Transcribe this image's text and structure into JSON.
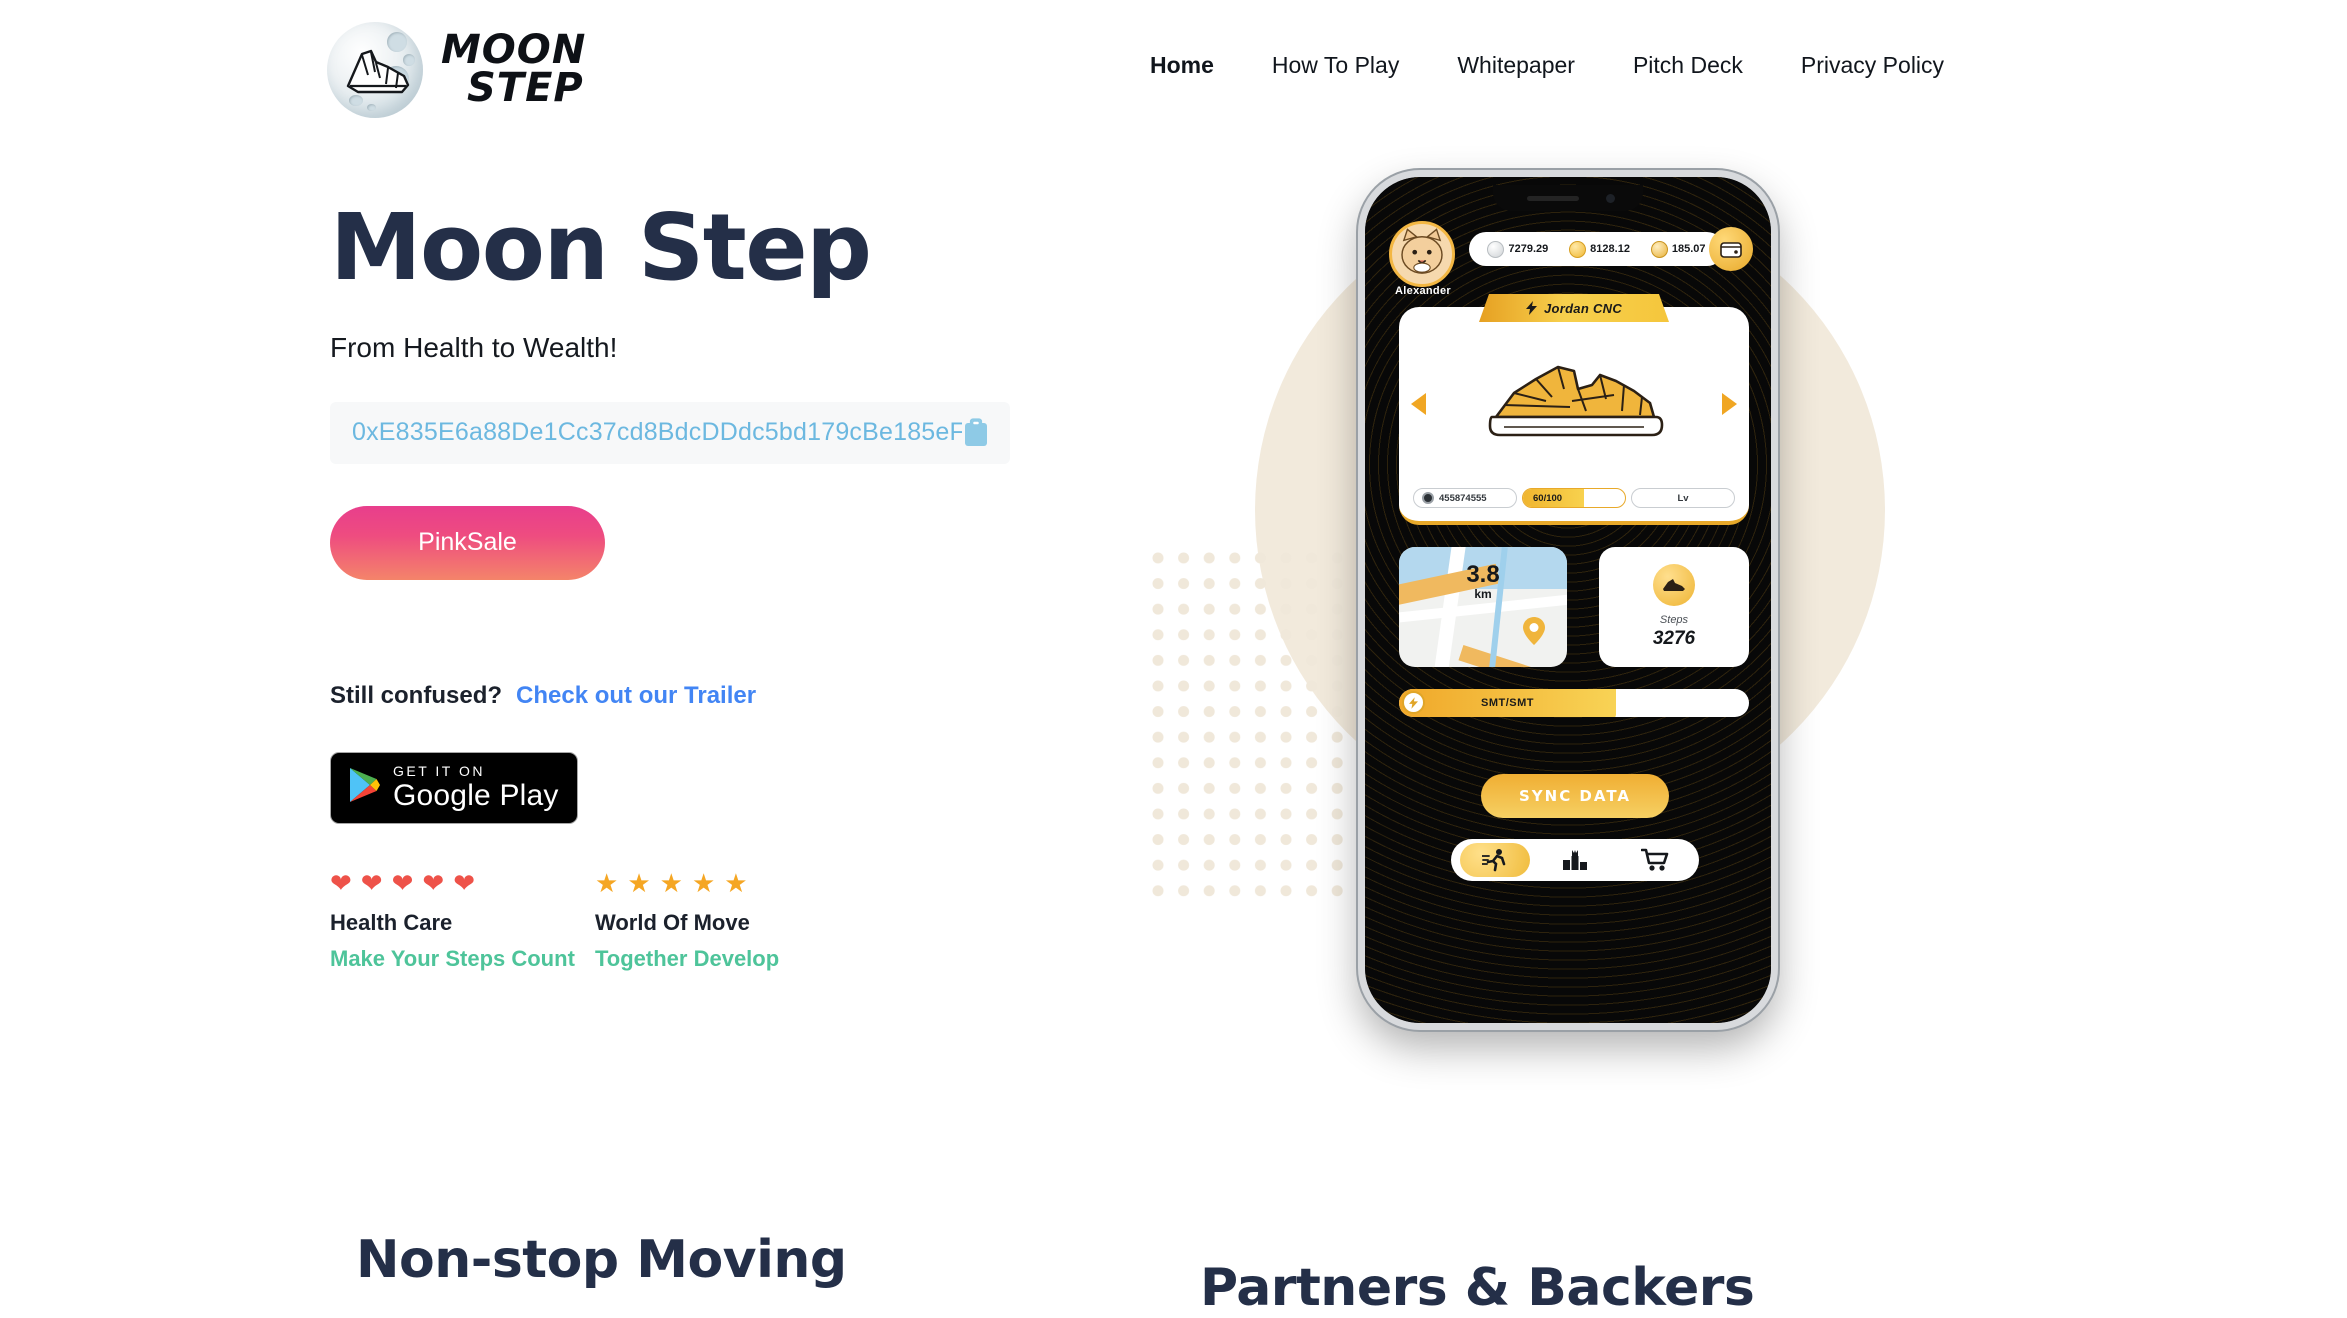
{
  "header": {
    "logo_alt": "moon-sneaker-logo",
    "brand_line1": "MOON",
    "brand_line2": "STEP",
    "nav": [
      {
        "label": "Home",
        "active": true
      },
      {
        "label": "How To Play",
        "active": false
      },
      {
        "label": "Whitepaper",
        "active": false
      },
      {
        "label": "Pitch Deck",
        "active": false
      },
      {
        "label": "Privacy Policy",
        "active": false
      }
    ]
  },
  "hero": {
    "title": "Moon Step",
    "subtitle": "From Health to Wealth!",
    "contract_address": "0xE835E6a88De1Cc37cd8BdcDDdc5bd179cBe185eF",
    "copy_icon": "clipboard-icon",
    "cta_label": "PinkSale",
    "confused_label": "Still confused?",
    "trailer_link": "Check out our Trailer",
    "google_play": {
      "small": "GET IT ON",
      "big": "Google Play",
      "icon": "google-play-icon"
    },
    "features": [
      {
        "icon": "heart-icon",
        "icon_count": 5,
        "icon_color": "#ee5249",
        "title": "Health Care",
        "subtitle": "Make Your Steps Count"
      },
      {
        "icon": "star-icon",
        "icon_count": 5,
        "icon_color": "#f5a623",
        "title": "World Of Move",
        "subtitle": "Together Develop"
      }
    ]
  },
  "phone": {
    "user_name": "Alexander",
    "avatar_icon": "cat-avatar-icon",
    "stats": [
      {
        "icon": "silver-coin-icon",
        "value": "7279.29"
      },
      {
        "icon": "energy-coin-icon",
        "value": "8128.12"
      },
      {
        "icon": "gold-token-icon",
        "value": "185.07"
      }
    ],
    "wallet_icon": "wallet-icon",
    "shoe_card": {
      "banner_icon": "bolt-icon",
      "banner_label": "Jordan CNC",
      "shoe_icon": "sneaker-icon",
      "prev_icon": "arrow-left-icon",
      "next_icon": "arrow-right-icon",
      "id_value": "455874555",
      "durability": "60/100",
      "durability_percent": 60,
      "level_label": "Lv"
    },
    "map_card": {
      "distance_value": "3.8",
      "distance_unit": "km",
      "pin_icon": "map-pin-icon"
    },
    "steps_card": {
      "icon": "sneaker-icon",
      "label": "Steps",
      "value": "3276"
    },
    "energy_bar": {
      "icon": "bolt-icon",
      "label": "SMT/SMT",
      "percent": 62
    },
    "sync_label": "SYNC DATA",
    "bottom_nav": [
      {
        "icon": "running-icon",
        "active": true
      },
      {
        "icon": "podium-icon",
        "active": false
      },
      {
        "icon": "cart-icon",
        "active": false
      }
    ]
  },
  "sections": {
    "nonstop_title": "Non-stop Moving",
    "partners_title": "Partners & Backers"
  },
  "colors": {
    "heading": "#242f48",
    "link_blue": "#4285f4",
    "address_blue": "#6cb8e0",
    "green": "#4ec49a",
    "gold": "#e8a92a",
    "pink": "#e83e8c"
  }
}
